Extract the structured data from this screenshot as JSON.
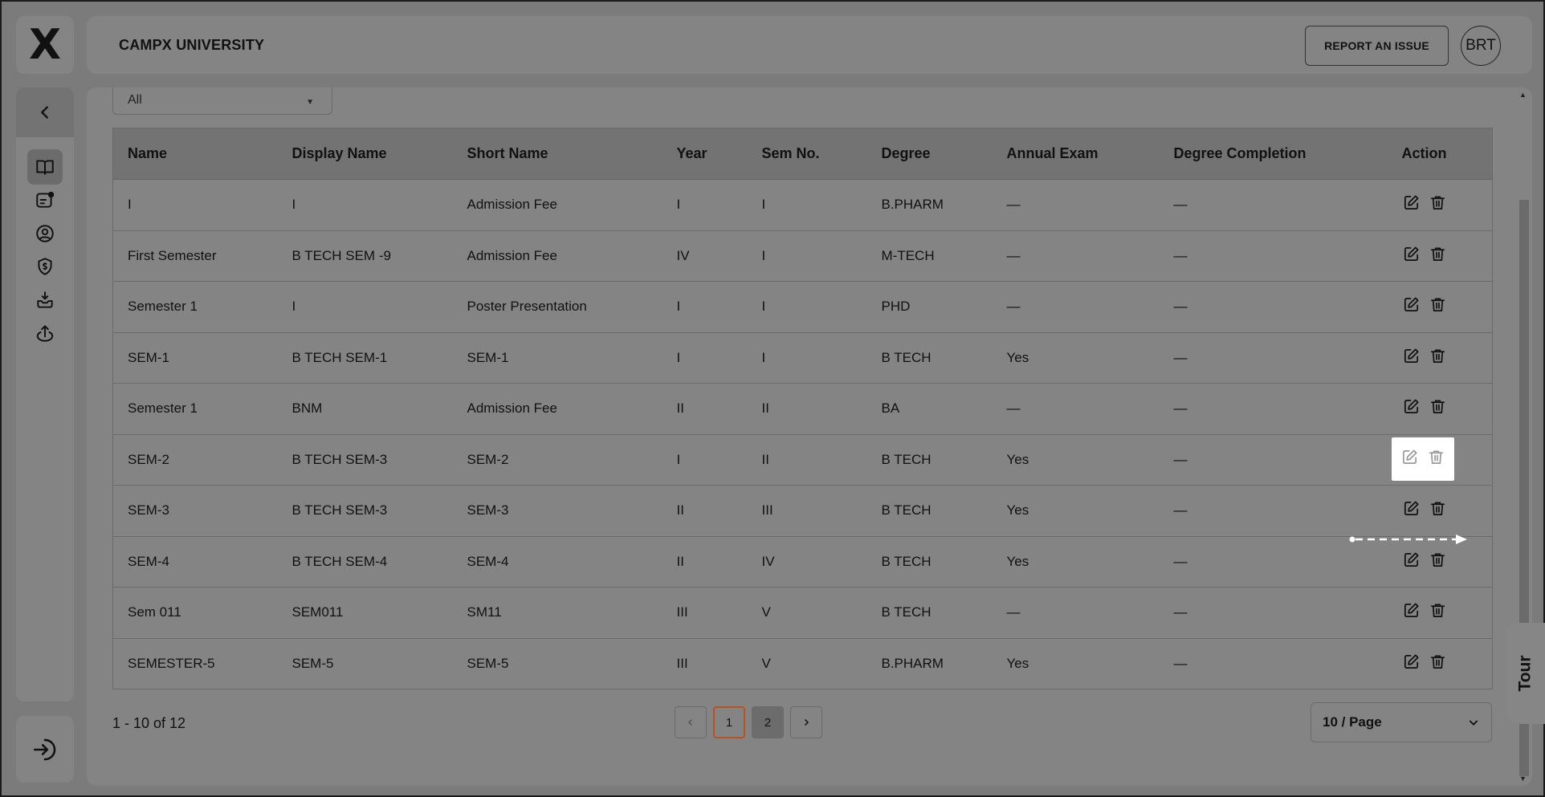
{
  "brand": {
    "logo_text": "X",
    "university": "CAMPX UNIVERSITY"
  },
  "header": {
    "report_label": "REPORT AN ISSUE",
    "avatar_initials": "BRT"
  },
  "sidebar": {
    "items": [
      {
        "icon": "institution-icon"
      },
      {
        "icon": "book-icon",
        "active": true
      },
      {
        "icon": "notice-icon"
      },
      {
        "icon": "user-circle-icon"
      },
      {
        "icon": "fee-shield-icon"
      },
      {
        "icon": "download-tray-icon"
      },
      {
        "icon": "upload-icon"
      }
    ]
  },
  "filter": {
    "value": "All"
  },
  "table": {
    "columns": [
      "Name",
      "Display Name",
      "Short Name",
      "Year",
      "Sem No.",
      "Degree",
      "Annual Exam",
      "Degree Completion",
      "Action"
    ],
    "rows": [
      {
        "name": "I",
        "display": "I",
        "short": "Admission Fee",
        "year": "I",
        "sem": "I",
        "degree": "B.PHARM",
        "annual": "—",
        "completion": "—"
      },
      {
        "name": "First Semester",
        "display": "B TECH SEM -9",
        "short": "Admission Fee",
        "year": "IV",
        "sem": "I",
        "degree": "M-TECH",
        "annual": "—",
        "completion": "—"
      },
      {
        "name": "Semester 1",
        "display": "I",
        "short": "Poster Presentation",
        "year": "I",
        "sem": "I",
        "degree": "PHD",
        "annual": "—",
        "completion": "—"
      },
      {
        "name": "SEM-1",
        "display": "B TECH SEM-1",
        "short": "SEM-1",
        "year": "I",
        "sem": "I",
        "degree": "B TECH",
        "annual": "Yes",
        "completion": "—"
      },
      {
        "name": "Semester 1",
        "display": "BNM",
        "short": "Admission Fee",
        "year": "II",
        "sem": "II",
        "degree": "BA",
        "annual": "—",
        "completion": "—"
      },
      {
        "name": "SEM-2",
        "display": "B TECH SEM-3",
        "short": "SEM-2",
        "year": "I",
        "sem": "II",
        "degree": "B TECH",
        "annual": "Yes",
        "completion": "—"
      },
      {
        "name": "SEM-3",
        "display": "B TECH SEM-3",
        "short": "SEM-3",
        "year": "II",
        "sem": "III",
        "degree": "B TECH",
        "annual": "Yes",
        "completion": "—"
      },
      {
        "name": "SEM-4",
        "display": "B TECH SEM-4",
        "short": "SEM-4",
        "year": "II",
        "sem": "IV",
        "degree": "B TECH",
        "annual": "Yes",
        "completion": "—"
      },
      {
        "name": "Sem 011",
        "display": "SEM011",
        "short": "SM11",
        "year": "III",
        "sem": "V",
        "degree": "B TECH",
        "annual": "—",
        "completion": "—"
      },
      {
        "name": "SEMESTER-5",
        "display": "SEM-5",
        "short": "SEM-5",
        "year": "III",
        "sem": "V",
        "degree": "B.PHARM",
        "annual": "Yes",
        "completion": "—"
      }
    ],
    "highlighted_row": 5
  },
  "pagination": {
    "range_text": "1 - 10 of 12",
    "pages": [
      "1",
      "2"
    ],
    "current": "1",
    "per_page": "10 / Page"
  },
  "tour": {
    "label": "Tour"
  },
  "colors": {
    "overlay_gray": "#7b7b7b",
    "panel_gray": "#848484",
    "current_page_border": "#b8521f",
    "highlight": "#ffffff"
  }
}
